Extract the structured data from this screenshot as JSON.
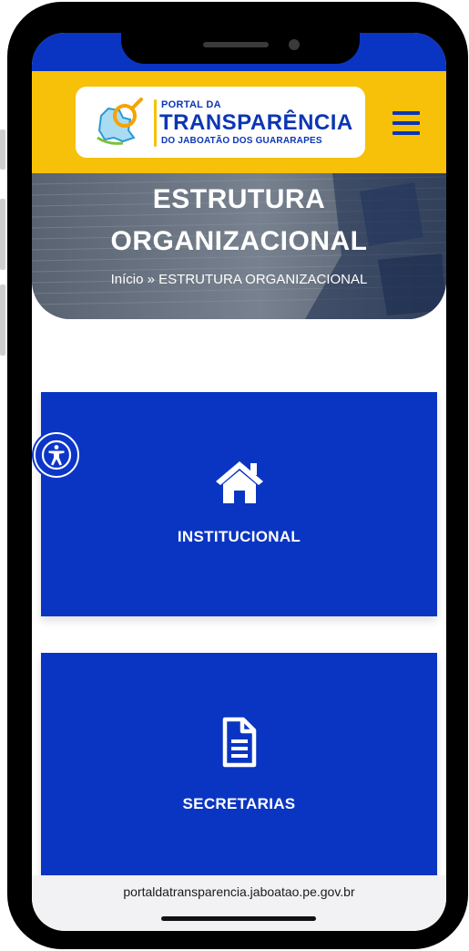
{
  "header": {
    "logo": {
      "line1": "PORTAL DA",
      "line2": "TRANSPARÊNCIA",
      "line3": "DO JABOATÃO DOS GUARARAPES"
    },
    "menu_icon": "hamburger-menu-icon"
  },
  "hero": {
    "title_line1": "ESTRUTURA",
    "title_line2": "ORGANIZACIONAL",
    "breadcrumb": "Início » ESTRUTURA ORGANIZACIONAL"
  },
  "cards": [
    {
      "label": "INSTITUCIONAL",
      "icon": "home-icon"
    },
    {
      "label": "SECRETARIAS",
      "icon": "document-icon"
    }
  ],
  "accessibility_icon": "accessibility-icon",
  "browser": {
    "url": "portaldatransparencia.jaboatao.pe.gov.br"
  },
  "colors": {
    "primary_blue": "#0a35c2",
    "header_yellow": "#f6c108",
    "logo_blue": "#0c36b4"
  }
}
